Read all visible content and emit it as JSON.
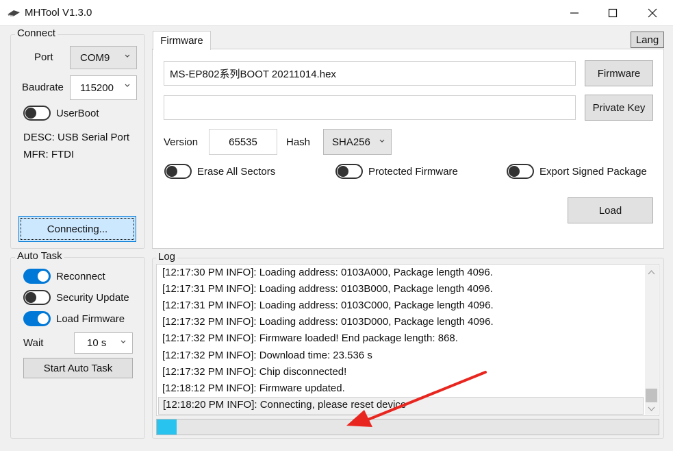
{
  "window": {
    "title": "MHTool V1.3.0"
  },
  "connect": {
    "legend": "Connect",
    "port_label": "Port",
    "port_value": "COM9",
    "baudrate_label": "Baudrate",
    "baudrate_value": "115200",
    "userboot_label": "UserBoot",
    "userboot_on": false,
    "desc": "DESC: USB Serial Port",
    "mfr": "MFR: FTDI",
    "connect_button": "Connecting..."
  },
  "firmware": {
    "tab_label": "Firmware",
    "lang_button": "Lang",
    "file_path": "MS-EP802系列BOOT 20211014.hex",
    "key_path": "",
    "firmware_button": "Firmware",
    "private_key_button": "Private Key",
    "version_label": "Version",
    "version_value": "65535",
    "hash_label": "Hash",
    "hash_value": "SHA256",
    "erase_label": "Erase All Sectors",
    "erase_on": false,
    "protected_label": "Protected Firmware",
    "protected_on": false,
    "export_label": "Export Signed Package",
    "export_on": false,
    "load_button": "Load"
  },
  "autotask": {
    "legend": "Auto Task",
    "reconnect_label": "Reconnect",
    "reconnect_on": true,
    "security_label": "Security Update",
    "security_on": false,
    "loadfw_label": "Load Firmware",
    "loadfw_on": true,
    "wait_label": "Wait",
    "wait_value": "10 s",
    "start_button": "Start Auto Task"
  },
  "log": {
    "legend": "Log",
    "lines": [
      "[12:17:30 PM INFO]: Loading address: 0103A000, Package length 4096.",
      "[12:17:31 PM INFO]: Loading address: 0103B000, Package length 4096.",
      "[12:17:31 PM INFO]: Loading address: 0103C000, Package length 4096.",
      "[12:17:32 PM INFO]: Loading address: 0103D000, Package length 4096.",
      "[12:17:32 PM INFO]: Firmware loaded! End package length: 868.",
      "[12:17:32 PM INFO]: Download time: 23.536 s",
      "[12:17:32 PM INFO]: Chip disconnected!",
      "[12:18:12 PM INFO]: Firmware updated.",
      "[12:18:20 PM INFO]: Connecting, please reset device"
    ],
    "progress_percent": 4
  },
  "colors": {
    "accent": "#0078d7",
    "progress": "#29c3f0",
    "annotation": "#e8261f"
  },
  "icons": {
    "app": "chip-icon",
    "minimize": "minimize-icon",
    "maximize": "maximize-icon",
    "close": "close-icon",
    "dropdown": "chevron-down-icon"
  }
}
